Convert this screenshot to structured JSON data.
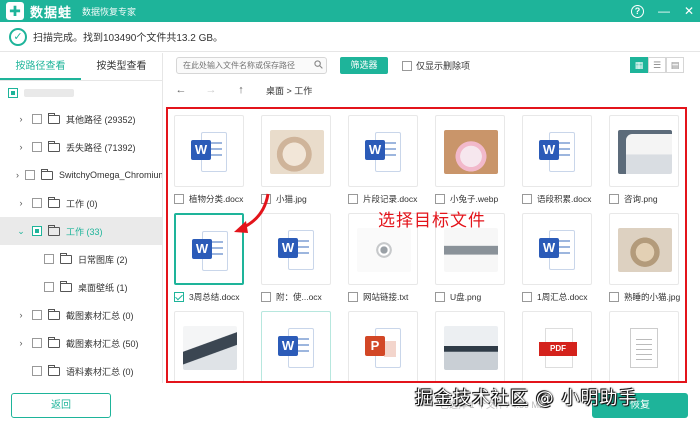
{
  "app": {
    "logo_glyph": "✚",
    "name": "数据蛙",
    "subtitle": "数据恢复专家",
    "help_glyph": "?",
    "minimize_glyph": "—",
    "close_glyph": "✕",
    "accent_color": "#1eb49a"
  },
  "status": {
    "check_glyph": "✓",
    "text": "扫描完成。找到103490个文件共13.2 GB。"
  },
  "sidebar": {
    "tabs": [
      {
        "label": "按路径查看",
        "active": true
      },
      {
        "label": "按类型查看",
        "active": false
      }
    ],
    "tree": [
      {
        "label": "其他路径 (29352)",
        "expanded": false
      },
      {
        "label": "丢失路径 (71392)",
        "expanded": false
      },
      {
        "label": "SwitchyOmega_Chromium",
        "expanded": false
      },
      {
        "label": "工作 (0)",
        "expanded": false
      },
      {
        "label": "工作 (33)",
        "expanded": true,
        "selected": true
      },
      {
        "label": "日常图库 (2)",
        "child": true
      },
      {
        "label": "桌面壁纸 (1)",
        "child": true
      },
      {
        "label": "截图素材汇总 (0)",
        "expanded": false
      },
      {
        "label": "截图素材汇总 (50)",
        "expanded": false
      },
      {
        "label": "语料素材汇总 (0)",
        "expanded": false
      }
    ],
    "back_label": "返回"
  },
  "toolbar": {
    "search_placeholder": "在此处输入文件名称或保存路径",
    "filter_label": "筛选器",
    "only_deleted_label": "仅显示删除项",
    "view_grid_glyph": "▦",
    "view_list_glyph": "☰",
    "view_detail_glyph": "▤"
  },
  "nav": {
    "back_glyph": "←",
    "forward_glyph": "→",
    "up_glyph": "↑",
    "breadcrumb": "桌面 > 工作"
  },
  "files": [
    {
      "name": "植物分类.docx",
      "type": "word"
    },
    {
      "name": "小猫.jpg",
      "type": "photo-cat"
    },
    {
      "name": "片段记录.docx",
      "type": "word"
    },
    {
      "name": "小兔子.webp",
      "type": "photo-rabbit"
    },
    {
      "name": "语段积累.docx",
      "type": "word"
    },
    {
      "name": "咨询.png",
      "type": "photo-office"
    },
    {
      "name": "3周总结.docx",
      "type": "word",
      "checked": true,
      "selected": true
    },
    {
      "name": "附：使...ocx",
      "type": "word"
    },
    {
      "name": "网站链接.txt",
      "type": "photo-key"
    },
    {
      "name": "U盘.png",
      "type": "photo-usb"
    },
    {
      "name": "1周汇总.docx",
      "type": "word"
    },
    {
      "name": "熟睡的小猫.jpg",
      "type": "photo-kitten"
    },
    {
      "name": "",
      "type": "photo-laptop"
    },
    {
      "name": "",
      "type": "word",
      "highlight": true
    },
    {
      "name": "",
      "type": "ppt"
    },
    {
      "name": "",
      "type": "photo-desk"
    },
    {
      "name": "",
      "type": "pdf"
    },
    {
      "name": "",
      "type": "txt"
    }
  ],
  "file_badges": {
    "word": "W",
    "ppt": "P",
    "pdf": "PDF"
  },
  "annotation": {
    "text": "选择目标文件",
    "color": "#e3141b"
  },
  "footer": {
    "status_text": "已选择 1 个文件 / 4.59 MB",
    "restore_label": "恢复"
  },
  "watermark": "掘金技术社区 @ 小明助手"
}
